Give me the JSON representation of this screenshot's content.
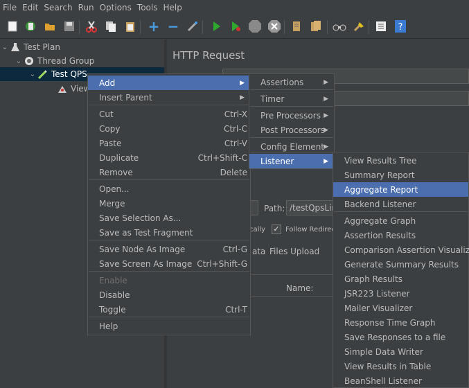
{
  "menubar": {
    "items": [
      "File",
      "Edit",
      "Search",
      "Run",
      "Options",
      "Tools",
      "Help"
    ]
  },
  "toolbar": {
    "icons": [
      "new-icon",
      "templates-icon",
      "open-icon",
      "save-icon",
      "cut-icon",
      "copy-icon",
      "paste-icon",
      "expand-icon",
      "collapse-icon",
      "toggle-icon",
      "start-icon",
      "start-no-pause-icon",
      "stop-icon",
      "shutdown-icon",
      "clear-icon",
      "clear-all-icon",
      "search-icon",
      "reset-search-icon",
      "function-helper-icon",
      "help-icon"
    ]
  },
  "tree": {
    "test_plan": "Test Plan",
    "thread_group": "Thread Group",
    "sampler": "Test QPS",
    "child": "View"
  },
  "panel": {
    "title": "HTTP Request",
    "path_label": "Path:",
    "path_value": "/testQpsLim",
    "follow_redirects": "Follow Redirect",
    "auto_redirect_partial": "cally",
    "tab_data_partial": "ata",
    "tab_files_upload": "Files Upload",
    "name_header": "Name:"
  },
  "context_menu": {
    "items": [
      {
        "label": "Add",
        "submenu": true
      },
      {
        "label": "Insert Parent",
        "submenu": true
      },
      {
        "label": "Cut",
        "accel": "Ctrl-X"
      },
      {
        "label": "Copy",
        "accel": "Ctrl-C"
      },
      {
        "label": "Paste",
        "accel": "Ctrl-V"
      },
      {
        "label": "Duplicate",
        "accel": "Ctrl+Shift-C"
      },
      {
        "label": "Remove",
        "accel": "Delete"
      },
      {
        "label": "Open..."
      },
      {
        "label": "Merge"
      },
      {
        "label": "Save Selection As..."
      },
      {
        "label": "Save as Test Fragment"
      },
      {
        "label": "Save Node As Image",
        "accel": "Ctrl-G"
      },
      {
        "label": "Save Screen As Image",
        "accel": "Ctrl+Shift-G"
      },
      {
        "label": "Enable"
      },
      {
        "label": "Disable"
      },
      {
        "label": "Toggle",
        "accel": "Ctrl-T"
      },
      {
        "label": "Help"
      }
    ]
  },
  "add_submenu": {
    "items": [
      "Assertions",
      "Timer",
      "Pre Processors",
      "Post Processors",
      "Config Element",
      "Listener"
    ]
  },
  "listener_submenu": {
    "items": [
      "View Results Tree",
      "Summary Report",
      "Aggregate Report",
      "Backend Listener",
      "Aggregate Graph",
      "Assertion Results",
      "Comparison Assertion Visualizer",
      "Generate Summary Results",
      "Graph Results",
      "JSR223 Listener",
      "Mailer Visualizer",
      "Response Time Graph",
      "Save Responses to a file",
      "Simple Data Writer",
      "View Results in Table",
      "BeanShell Listener"
    ]
  },
  "colors": {
    "selection": "#4b6eaf",
    "background": "#3c3f41",
    "text": "#bbbbbb"
  }
}
